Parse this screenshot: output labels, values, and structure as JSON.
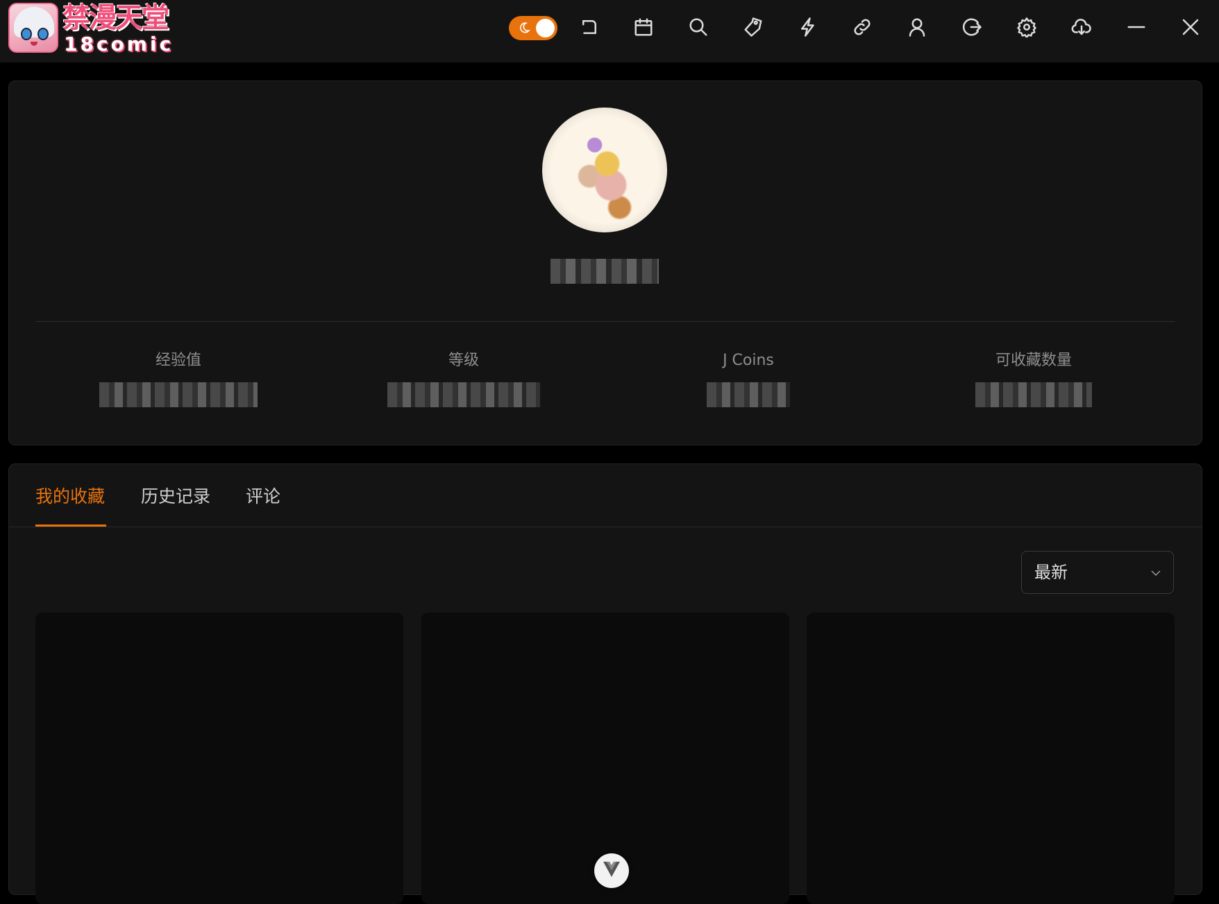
{
  "app": {
    "logo_title": "禁漫天堂",
    "logo_subtitle": "18comic"
  },
  "toolbar": {
    "theme_toggle": "dark",
    "icons": [
      "back-icon",
      "calendar-icon",
      "search-icon",
      "tag-icon",
      "lightning-icon",
      "link-icon",
      "user-icon",
      "logout-icon",
      "settings-icon",
      "cloud-download-icon",
      "minimize-icon",
      "close-icon"
    ]
  },
  "profile": {
    "stats": [
      {
        "label": "经验值"
      },
      {
        "label": "等级"
      },
      {
        "label": "J Coins"
      },
      {
        "label": "可收藏数量"
      }
    ]
  },
  "tabs": [
    {
      "label": "我的收藏",
      "active": true
    },
    {
      "label": "历史记录",
      "active": false
    },
    {
      "label": "评论",
      "active": false
    }
  ],
  "sort": {
    "selected": "最新"
  },
  "colors": {
    "accent": "#e8730c",
    "background": "#000000",
    "panel": "#141414"
  }
}
